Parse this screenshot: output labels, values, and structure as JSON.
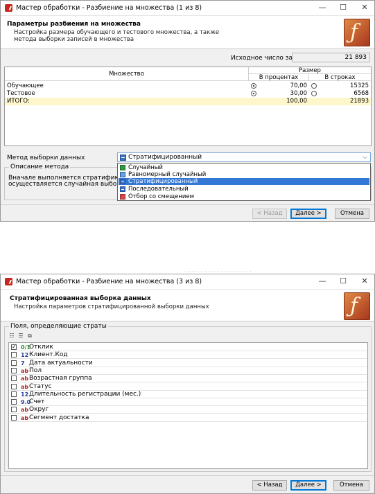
{
  "dialog1": {
    "title": "Мастер обработки - Разбиение на множества (1 из 8)",
    "header_title": "Параметры разбиения на множества",
    "header_subtitle_1": "Настройка размера обучающего и тестового множества, а также",
    "header_subtitle_2": "метода выборки записей в множества",
    "source_count_label": "Исходное число записей",
    "source_count_value": "21 893",
    "table": {
      "col_set": "Множество",
      "col_size": "Размер",
      "col_percent": "В процентах",
      "col_rows": "В строках",
      "rows": [
        {
          "name": "Обучающее",
          "percent": "70,00",
          "rows": "15325",
          "percent_selected": true
        },
        {
          "name": "Тестовое",
          "percent": "30,00",
          "rows": "6568",
          "percent_selected": true
        }
      ],
      "total": {
        "name": "ИТОГО:",
        "percent": "100,00",
        "rows": "21893"
      }
    },
    "method_label": "Метод выборки данных",
    "method_value": "Стратифицированный",
    "method_options": [
      "Случайный",
      "Равномерный случайный",
      "Стратифицированный",
      "Последовательный",
      "Отбор со смещением"
    ],
    "method_selected_index": 2,
    "description_title": "Описание метода",
    "description_line_1": "Вначале выполняется стратификация - группи",
    "description_line_2": "осуществляется случайная выборка из каждо",
    "buttons": {
      "back": "< Назад",
      "next": "Далее >",
      "cancel": "Отмена"
    }
  },
  "dialog2": {
    "title": "Мастер обработки - Разбиение на множества (3 из 8)",
    "header_title": "Стратифицированная выборка данных",
    "header_subtitle": "Настройка параметров стратифицированной выборки данных",
    "group_title": "Поля, определяющие страты",
    "fields": [
      {
        "type": "0/1",
        "kind": "bool",
        "name": "Отклик",
        "checked": true
      },
      {
        "type": "12",
        "kind": "num",
        "name": "Клиент.Код",
        "checked": false
      },
      {
        "type": "7",
        "kind": "date",
        "name": "Дата актуальности",
        "checked": false
      },
      {
        "type": "ab",
        "kind": "str",
        "name": "Пол",
        "checked": false
      },
      {
        "type": "ab",
        "kind": "str",
        "name": "Возрастная группа",
        "checked": false
      },
      {
        "type": "ab",
        "kind": "str",
        "name": "Статус",
        "checked": false
      },
      {
        "type": "12",
        "kind": "num",
        "name": "Длительность регистрации (мес.)",
        "checked": false
      },
      {
        "type": "9.0",
        "kind": "num",
        "name": "Счет",
        "checked": false
      },
      {
        "type": "ab",
        "kind": "str",
        "name": "Округ",
        "checked": false
      },
      {
        "type": "ab",
        "kind": "str",
        "name": "Сегмент достатка",
        "checked": false
      }
    ],
    "buttons": {
      "back": "< Назад",
      "next": "Далее >",
      "cancel": "Отмена"
    }
  },
  "window_controls": {
    "minimize": "—",
    "maximize": "☐",
    "close": "✕"
  },
  "logo_glyph": "ƒ"
}
